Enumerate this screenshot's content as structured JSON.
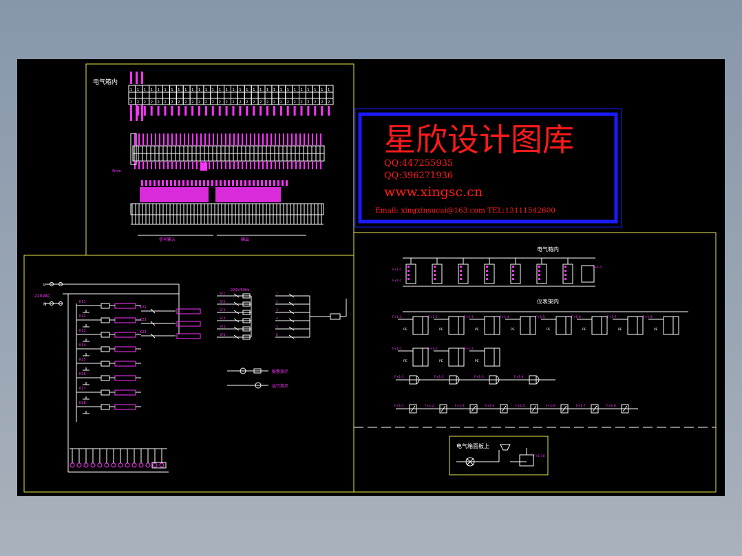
{
  "colors": {
    "background": "#000000",
    "frame": "#e8e84a",
    "wire": "#ffffff",
    "label": "#ff33ff",
    "watermark_text": "#ff1a1a",
    "watermark_border": "#1a1aff"
  },
  "panels": {
    "top_left_title": "电气箱内",
    "top_left_bus_label_1": "信号输入",
    "top_left_bus_label_2": "输出",
    "right_title_1": "电气箱内",
    "right_title_2": "仪表架内",
    "bottom_right_title": "电气箱面板上"
  },
  "watermark": {
    "title": "星欣设计图库",
    "qq1": "QQ:447255935",
    "qq2": "QQ:396271936",
    "website": "www.xingsc.cn",
    "contact": "Email: xingxinsucai@163.com   TEL:13111542600"
  },
  "left_schematic": {
    "supply_label": "220VAC",
    "supply_node_n": "N",
    "supply_node_l": "L",
    "relay_labels": [
      "K11",
      "K12",
      "K13",
      "K14",
      "K15",
      "K16",
      "K17",
      "K18"
    ],
    "output_labels": [
      "K21",
      "K22",
      "K23"
    ],
    "mid_header": "220V/50Hz",
    "mid_contacts": [
      "SF1",
      "SF2",
      "SF3",
      "SF4",
      "SF5",
      "SF6"
    ],
    "lamp_labels": [
      "报警指示",
      "运行指示"
    ]
  },
  "icons": {
    "relay": "relay-coil-icon",
    "contact": "switch-contact-icon",
    "lamp": "indicator-lamp-icon",
    "terminal": "terminal-block-icon"
  }
}
